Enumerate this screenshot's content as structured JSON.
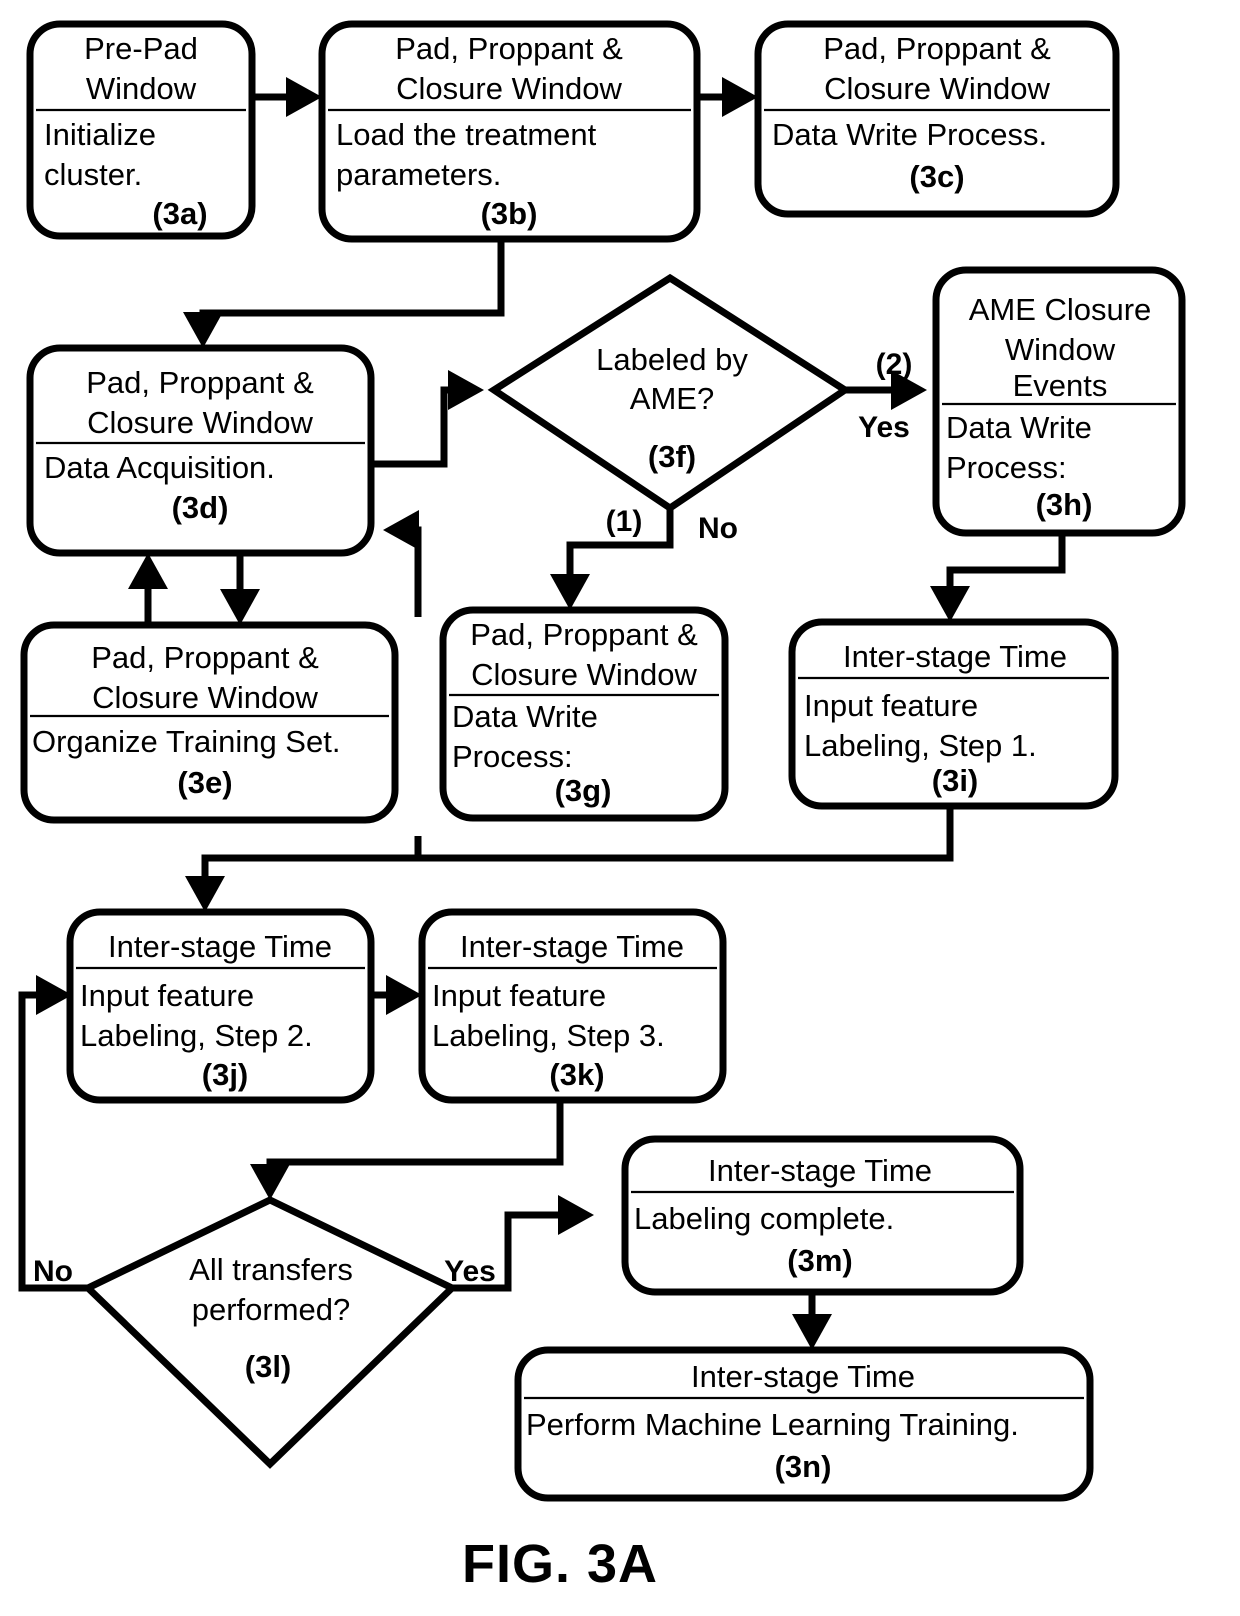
{
  "figure": {
    "caption": "FIG. 3A",
    "type": "flowchart"
  },
  "nodes": [
    {
      "id": "3a",
      "header": [
        "Pre-Pad",
        "Window"
      ],
      "body": [
        "Initialize",
        "cluster."
      ],
      "ref": "(3a)",
      "body_align": "start"
    },
    {
      "id": "3b",
      "header": [
        "Pad, Proppant &",
        "Closure Window"
      ],
      "body": [
        "Load the treatment",
        "parameters."
      ],
      "ref": "(3b)",
      "body_align": "start"
    },
    {
      "id": "3c",
      "header": [
        "Pad, Proppant &",
        "Closure Window"
      ],
      "body": [
        "Data Write Process."
      ],
      "ref": "(3c)",
      "body_align": "start"
    },
    {
      "id": "3d",
      "header": [
        "Pad, Proppant &",
        "Closure Window"
      ],
      "body": [
        "Data Acquisition."
      ],
      "ref": "(3d)",
      "body_align": "start"
    },
    {
      "id": "3e",
      "header": [
        "Pad, Proppant &",
        "Closure Window"
      ],
      "body": [
        "Organize Training Set."
      ],
      "ref": "(3e)",
      "body_align": "start"
    },
    {
      "id": "3f",
      "shape": "diamond",
      "body": [
        "Labeled by",
        "AME?"
      ],
      "ref": "(3f)"
    },
    {
      "id": "3g",
      "header": [
        "Pad, Proppant &",
        "Closure Window"
      ],
      "body": [
        "Data Write",
        "Process:"
      ],
      "ref": "(3g)",
      "body_align": "start"
    },
    {
      "id": "3h",
      "header": [
        "AME Closure",
        "Window",
        "Events"
      ],
      "body": [
        "Data Write",
        "Process:"
      ],
      "ref": "(3h)",
      "body_align": "start"
    },
    {
      "id": "3i",
      "header": [
        "Inter-stage Time"
      ],
      "body": [
        "Input feature",
        "Labeling, Step 1."
      ],
      "ref": "(3i)",
      "body_align": "start"
    },
    {
      "id": "3j",
      "header": [
        "Inter-stage Time"
      ],
      "body": [
        "Input feature",
        "Labeling, Step 2."
      ],
      "ref": "(3j)",
      "body_align": "start"
    },
    {
      "id": "3k",
      "header": [
        "Inter-stage Time"
      ],
      "body": [
        "Input feature",
        "Labeling, Step 3."
      ],
      "ref": "(3k)",
      "body_align": "start"
    },
    {
      "id": "3l",
      "shape": "diamond",
      "body": [
        "All transfers",
        "performed?"
      ],
      "ref": "(3l)"
    },
    {
      "id": "3m",
      "header": [
        "Inter-stage Time"
      ],
      "body": [
        "Labeling complete."
      ],
      "ref": "(3m)",
      "body_align": "start"
    },
    {
      "id": "3n",
      "header": [
        "Inter-stage Time"
      ],
      "body": [
        "Perform Machine Learning Training."
      ],
      "ref": "(3n)",
      "body_align": "start"
    }
  ],
  "edge_labels": {
    "ame_yes_num": "(2)",
    "ame_yes": "Yes",
    "ame_no_num": "(1)",
    "ame_no": "No",
    "transfers_no": "No",
    "transfers_yes": "Yes"
  },
  "text": {
    "n3a_h1": "Pre-Pad",
    "n3a_h2": "Window",
    "n3a_b1": "Initialize",
    "n3a_b2": "cluster.",
    "n3a_ref": "(3a)",
    "n3b_h1": "Pad, Proppant &",
    "n3b_h2": "Closure Window",
    "n3b_b1": "Load the treatment",
    "n3b_b2": "parameters.",
    "n3b_ref": "(3b)",
    "n3c_h1": "Pad, Proppant &",
    "n3c_h2": "Closure Window",
    "n3c_b1": "Data Write Process.",
    "n3c_ref": "(3c)",
    "n3d_h1": "Pad, Proppant &",
    "n3d_h2": "Closure Window",
    "n3d_b1": "Data Acquisition.",
    "n3d_ref": "(3d)",
    "n3e_h1": "Pad, Proppant &",
    "n3e_h2": "Closure Window",
    "n3e_b1": "Organize Training Set.",
    "n3e_ref": "(3e)",
    "n3f_b1": "Labeled by",
    "n3f_b2": "AME?",
    "n3f_ref": "(3f)",
    "n3g_h1": "Pad, Proppant &",
    "n3g_h2": "Closure Window",
    "n3g_b1": "Data Write",
    "n3g_b2": "Process:",
    "n3g_ref": "(3g)",
    "n3h_h1": "AME Closure",
    "n3h_h2": "Window",
    "n3h_h3": "Events",
    "n3h_b1": "Data Write",
    "n3h_b2": "Process:",
    "n3h_ref": "(3h)",
    "n3i_h1": "Inter-stage Time",
    "n3i_b1": "Input feature",
    "n3i_b2": "Labeling, Step 1.",
    "n3i_ref": "(3i)",
    "n3j_h1": "Inter-stage Time",
    "n3j_b1": "Input feature",
    "n3j_b2": "Labeling, Step 2.",
    "n3j_ref": "(3j)",
    "n3k_h1": "Inter-stage Time",
    "n3k_b1": "Input feature",
    "n3k_b2": "Labeling, Step 3.",
    "n3k_ref": "(3k)",
    "n3l_b1": "All transfers",
    "n3l_b2": "performed?",
    "n3l_ref": "(3l)",
    "n3m_h1": "Inter-stage Time",
    "n3m_b1": "Labeling complete.",
    "n3m_ref": "(3m)",
    "n3n_h1": "Inter-stage Time",
    "n3n_b1": "Perform Machine Learning Training.",
    "n3n_ref": "(3n)",
    "lbl_2": "(2)",
    "lbl_yes_ame": "Yes",
    "lbl_1": "(1)",
    "lbl_no_ame": "No",
    "lbl_no_transfers": "No",
    "lbl_yes_transfers": "Yes",
    "figure_caption": "FIG. 3A"
  },
  "colors": {
    "stroke": "#000000",
    "fill": "#ffffff"
  }
}
